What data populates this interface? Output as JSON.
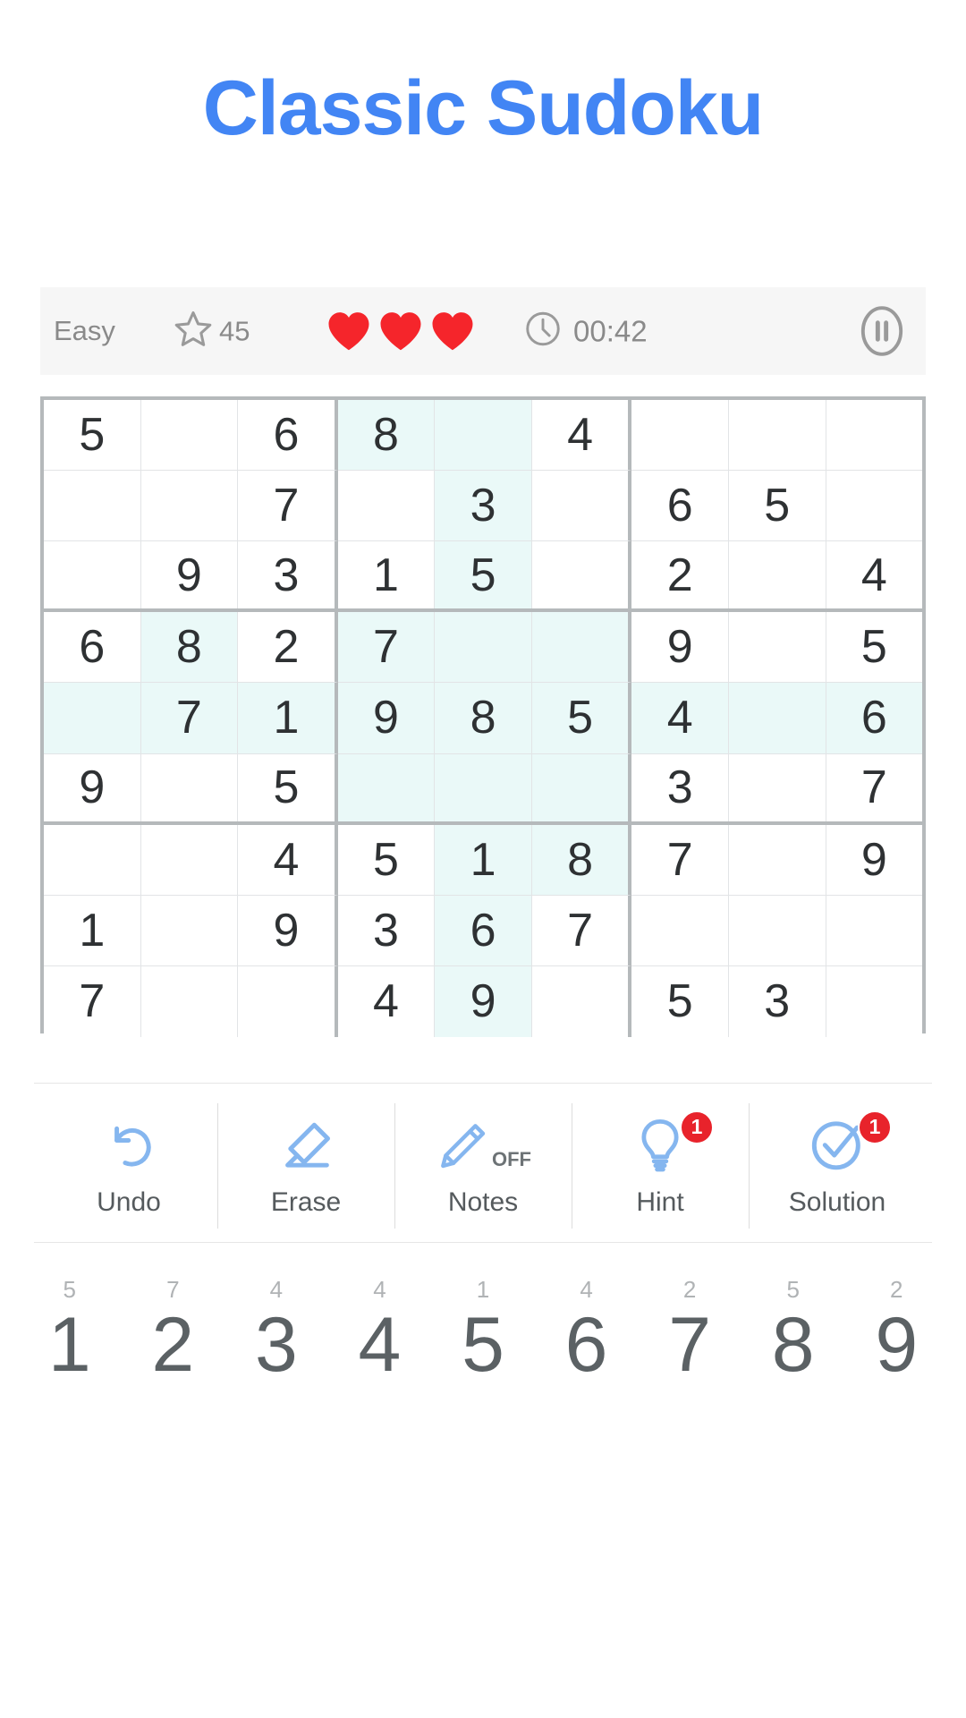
{
  "app": {
    "title": "Classic Sudoku",
    "title_color": "#4285f4"
  },
  "status": {
    "difficulty": "Easy",
    "score": "45",
    "star_icon": "star-icon",
    "hearts": 3,
    "heart_icon": "heart-icon",
    "heart_color": "#f5252b",
    "clock_icon": "clock-icon",
    "time": "00:42",
    "pause_icon": "pause-icon"
  },
  "board": {
    "highlight_color": "#eaf9f8",
    "grid_line_color": "#e2e4e6",
    "box_line_color": "#b5b9bb",
    "rows": [
      [
        "5",
        "",
        "6",
        "8",
        "",
        "4",
        "",
        "",
        ""
      ],
      [
        "",
        "",
        "7",
        "",
        "3",
        "",
        "6",
        "5",
        ""
      ],
      [
        "",
        "9",
        "3",
        "1",
        "5",
        "",
        "2",
        "",
        "4"
      ],
      [
        "6",
        "8",
        "2",
        "7",
        "",
        "",
        "9",
        "",
        "5"
      ],
      [
        "",
        "7",
        "1",
        "9",
        "8",
        "5",
        "4",
        "",
        "6"
      ],
      [
        "9",
        "",
        "5",
        "",
        "",
        "",
        "3",
        "",
        "7"
      ],
      [
        "",
        "",
        "4",
        "5",
        "1",
        "8",
        "7",
        "",
        "9"
      ],
      [
        "1",
        "",
        "9",
        "3",
        "6",
        "7",
        "",
        "",
        ""
      ],
      [
        "7",
        "",
        "",
        "4",
        "9",
        "",
        "5",
        "3",
        ""
      ]
    ],
    "highlighted": [
      [
        0,
        0,
        0,
        1,
        1,
        0,
        0,
        0,
        0
      ],
      [
        0,
        0,
        0,
        0,
        1,
        0,
        0,
        0,
        0
      ],
      [
        0,
        0,
        0,
        0,
        1,
        0,
        0,
        0,
        0
      ],
      [
        0,
        1,
        0,
        1,
        1,
        1,
        0,
        0,
        0
      ],
      [
        1,
        1,
        1,
        1,
        1,
        1,
        1,
        1,
        1
      ],
      [
        0,
        0,
        0,
        1,
        1,
        1,
        0,
        0,
        0
      ],
      [
        0,
        0,
        0,
        0,
        1,
        1,
        0,
        0,
        0
      ],
      [
        0,
        0,
        0,
        0,
        1,
        0,
        0,
        0,
        0
      ],
      [
        0,
        0,
        0,
        0,
        1,
        0,
        0,
        0,
        0
      ]
    ]
  },
  "toolbar": {
    "items": [
      {
        "label": "Undo",
        "icon": "undo-icon",
        "badge": ""
      },
      {
        "label": "Erase",
        "icon": "eraser-icon",
        "badge": ""
      },
      {
        "label": "Notes",
        "icon": "pencil-icon",
        "badge": "",
        "state": "OFF"
      },
      {
        "label": "Hint",
        "icon": "lightbulb-icon",
        "badge": "1"
      },
      {
        "label": "Solution",
        "icon": "check-circle-icon",
        "badge": "1"
      }
    ],
    "icon_color": "#85b6ef",
    "badge_color": "#e8232b"
  },
  "numpad": {
    "keys": [
      {
        "digit": "1",
        "count": "5"
      },
      {
        "digit": "2",
        "count": "7"
      },
      {
        "digit": "3",
        "count": "4"
      },
      {
        "digit": "4",
        "count": "4"
      },
      {
        "digit": "5",
        "count": "1"
      },
      {
        "digit": "6",
        "count": "4"
      },
      {
        "digit": "7",
        "count": "2"
      },
      {
        "digit": "8",
        "count": "5"
      },
      {
        "digit": "9",
        "count": "2"
      }
    ]
  }
}
